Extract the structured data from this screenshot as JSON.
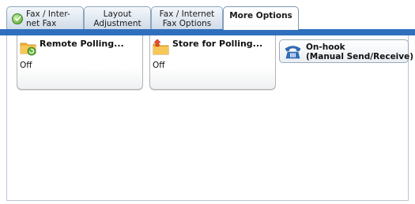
{
  "tabs": [
    {
      "label": "Fax / Inter-\nnet Fax",
      "active": false,
      "icon": "check-circle-icon"
    },
    {
      "label": "Layout\nAdjustment",
      "active": false
    },
    {
      "label": "Fax / Internet\nFax Options",
      "active": false
    },
    {
      "label": "More Options",
      "active": true
    }
  ],
  "buttons": {
    "remote_polling": {
      "title": "Remote Polling...",
      "value": "Off",
      "icon": "folder-polling-icon"
    },
    "store_for_polling": {
      "title": "Store for Polling...",
      "value": "Off",
      "icon": "folder-store-icon"
    },
    "on_hook": {
      "title": "On-hook\n(Manual Send/Receive)",
      "icon": "telephone-icon"
    }
  },
  "colors": {
    "band": "#2f6fbe",
    "tab_gradient_top": "#f4f8fc",
    "tab_gradient_bottom": "#cfdbe7",
    "active_tab": "#ffffff"
  }
}
